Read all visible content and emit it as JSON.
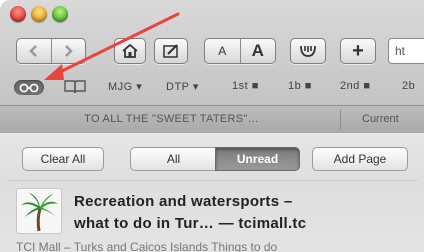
{
  "toolbar": {
    "back_icon": "chevron-left-icon",
    "forward_icon": "chevron-right-icon",
    "home_icon": "house-icon",
    "edit_icon": "pencil-note-icon",
    "font_small_label": "A",
    "font_large_label": "A",
    "toolbar_icon": "bucket-icon",
    "add_label": "+",
    "url_value": "ht"
  },
  "bookmarks": {
    "reader_icon": "glasses-icon",
    "book_icon": "open-book-icon",
    "items": [
      "MJG ▾",
      "DTP ▾",
      "1st ■",
      "1b ■",
      "2nd ■",
      "2b"
    ]
  },
  "tabs": {
    "active_label": "TO ALL THE \"SWEET TATERS\"…",
    "other_label": "Current"
  },
  "reading_list": {
    "clear_all_label": "Clear All",
    "filter_all_label": "All",
    "filter_unread_label": "Unread",
    "add_page_label": "Add Page",
    "item": {
      "title_line1": "Recreation and watersports –",
      "title_line2": "what to do in Tur… — tcimall.tc",
      "subtitle": "TCI Mall – Turks and Caicos Islands Things to do",
      "thumb_icon": "palm-tree-icon"
    }
  },
  "annotation": {
    "color": "#e8453c"
  }
}
